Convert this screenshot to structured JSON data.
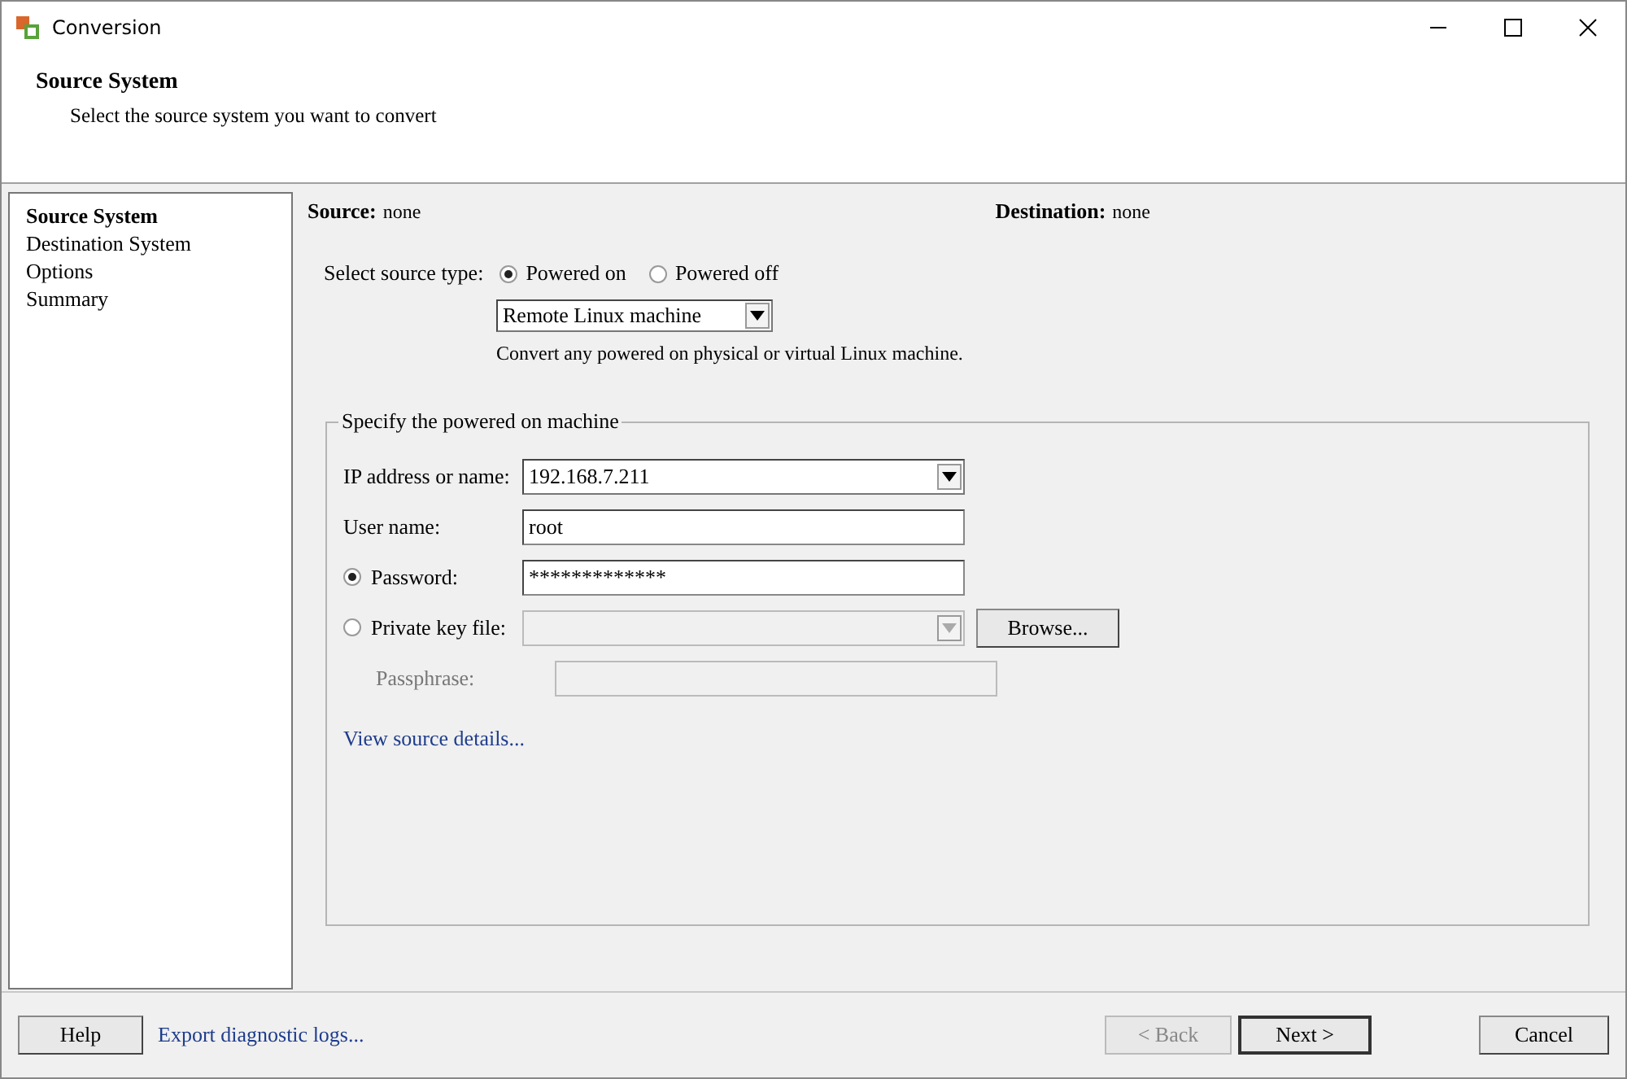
{
  "window": {
    "title": "Conversion"
  },
  "header": {
    "title": "Source System",
    "subtitle": "Select the source system you want to convert"
  },
  "sidebar": {
    "items": [
      {
        "label": "Source System",
        "selected": true
      },
      {
        "label": "Destination System",
        "selected": false
      },
      {
        "label": "Options",
        "selected": false
      },
      {
        "label": "Summary",
        "selected": false
      }
    ]
  },
  "summary": {
    "source_label": "Source:",
    "source_value": "none",
    "destination_label": "Destination:",
    "destination_value": "none"
  },
  "source_type": {
    "label": "Select source type:",
    "options": [
      {
        "label": "Powered on",
        "selected": true
      },
      {
        "label": "Powered off",
        "selected": false
      }
    ],
    "machine_type": "Remote Linux machine",
    "description": "Convert any powered on physical or virtual Linux machine."
  },
  "group": {
    "title": "Specify the powered on machine",
    "fields": [
      {
        "kind": "combo",
        "label": "IP address or name:",
        "value": "192.168.7.211",
        "disabled": false
      },
      {
        "kind": "text",
        "label": "User name:",
        "value": "root",
        "disabled": false
      },
      {
        "kind": "radio-text",
        "label": "Password:",
        "value": "*************",
        "selected": true,
        "disabled": false
      },
      {
        "kind": "radio-combo",
        "label": "Private key file:",
        "selected": false,
        "disabled": true,
        "button": "Browse..."
      },
      {
        "kind": "text",
        "label": "Passphrase:",
        "disabled": true
      }
    ],
    "link": "View source details..."
  },
  "footer": {
    "help": "Help",
    "export_link": "Export diagnostic logs...",
    "back": {
      "label": "< Back",
      "disabled": true
    },
    "next": {
      "label": "Next >",
      "disabled": false
    },
    "cancel": "Cancel"
  }
}
